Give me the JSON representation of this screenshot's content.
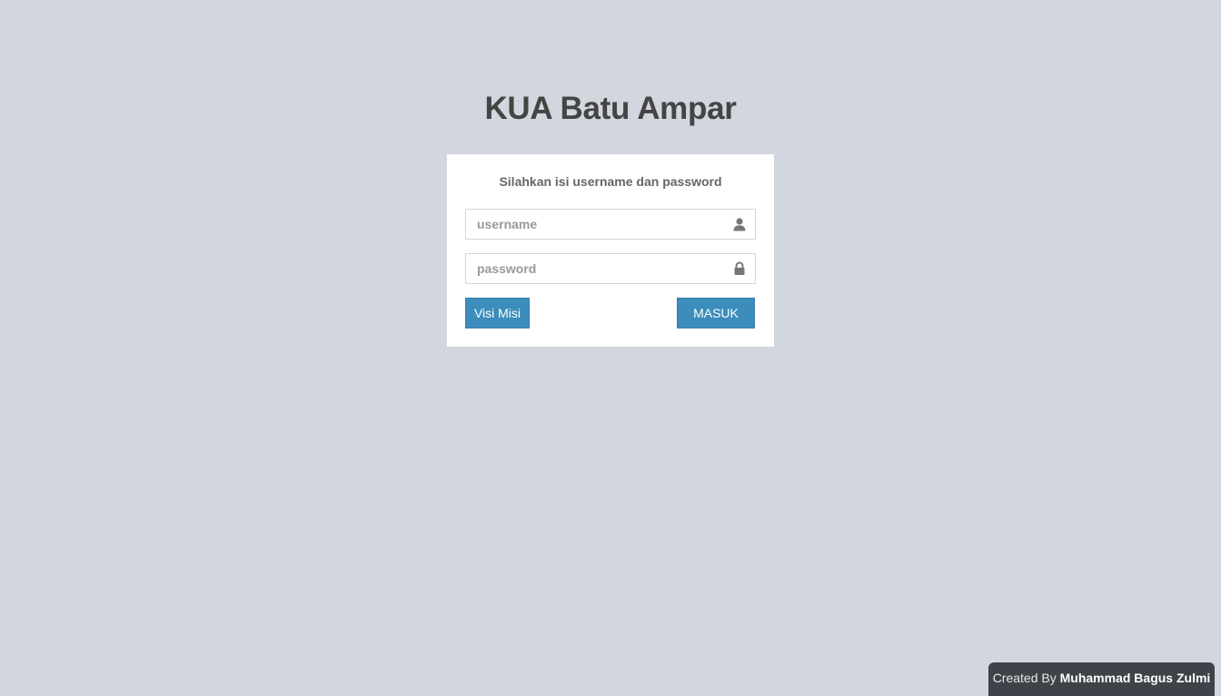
{
  "header": {
    "title": "KUA Batu Ampar"
  },
  "login": {
    "message": "Silahkan isi username dan password",
    "username": {
      "placeholder": "username",
      "value": "",
      "icon": "user-icon"
    },
    "password": {
      "placeholder": "password",
      "value": "",
      "icon": "lock-icon"
    },
    "visi_misi_label": "Visi Misi",
    "submit_label": "MASUK"
  },
  "footer": {
    "credit_prefix": "Created By",
    "credit_name": "Muhammad Bagus Zulmi"
  },
  "colors": {
    "background": "#d2d6de",
    "primary_button": "#3c8dbc",
    "credit_bg": "#3e4349",
    "title": "#444444"
  }
}
